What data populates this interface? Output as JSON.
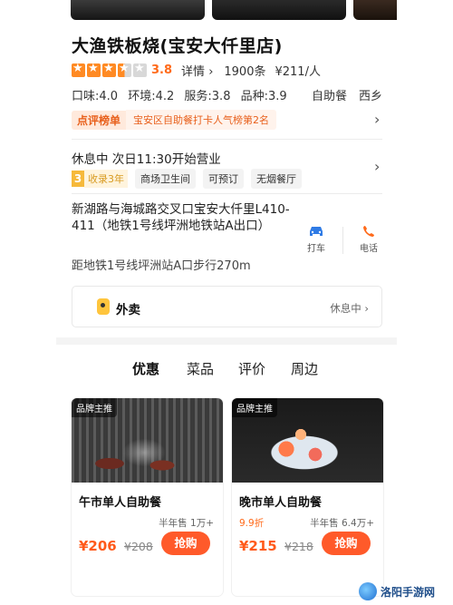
{
  "store": {
    "name": "大渔铁板烧(宝安大仟里店)",
    "rating": {
      "stars": 3.5,
      "score": "3.8",
      "detail_label": "详情",
      "reviews": "1900条",
      "price": "¥211/人"
    },
    "sub_scores": {
      "taste": "口味:4.0",
      "environment": "环境:4.2",
      "service": "服务:3.8",
      "variety": "品种:3.9",
      "category": "自助餐",
      "category2": "西乡"
    },
    "rank": {
      "tag": "点评榜单",
      "text": "宝安区自助餐打卡人气榜第2名"
    },
    "hours": "休息中 次日11:30开始营业",
    "tags": {
      "badge_num": "3",
      "years": "收录3年",
      "items": [
        "商场卫生间",
        "可预订",
        "无烟餐厅"
      ]
    },
    "address": "新湖路与海城路交叉口宝安大仟里L410-411（地铁1号线坪洲地铁站A出口）",
    "distance": "距地铁1号线坪洲站A口步行270m",
    "actions": {
      "drive": "打车",
      "call": "电话"
    },
    "takeout": {
      "label": "外卖",
      "status": "休息中"
    }
  },
  "tabs": [
    "优惠",
    "菜品",
    "评价",
    "周边"
  ],
  "deals": [
    {
      "badge": "品牌主推",
      "name": "午市单人自助餐",
      "discount": "",
      "sold": "半年售 1万+",
      "price": "¥206",
      "original": "¥208",
      "button": "抢购"
    },
    {
      "badge": "品牌主推",
      "name": "晚市单人自助餐",
      "discount": "9.9折",
      "sold": "半年售 6.4万+",
      "price": "¥215",
      "original": "¥218",
      "button": "抢购"
    }
  ],
  "watermark": "洛阳手游网",
  "colors": {
    "accent": "#ff6a1a",
    "star": "#ff8a23",
    "buy_button": "#ff5a2a",
    "rank_bg": "#ffe9dc"
  }
}
